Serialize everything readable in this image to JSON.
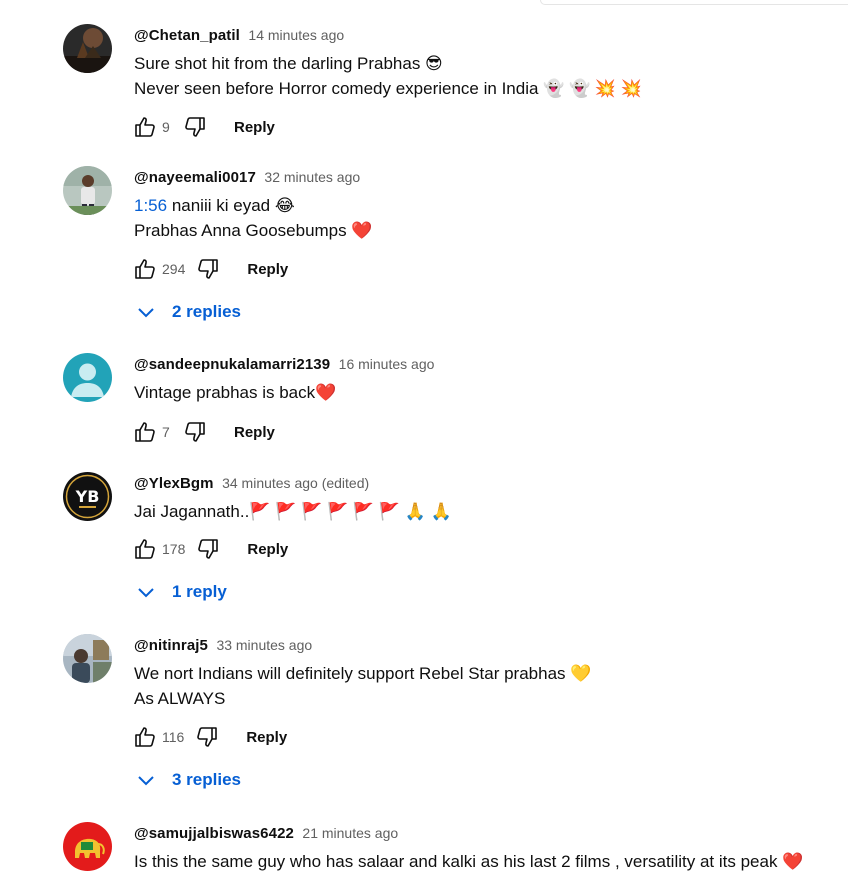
{
  "comments": [
    {
      "author": "@Chetan_patil",
      "time": "14 minutes ago",
      "lines": [
        {
          "timestamp": "",
          "text": "Sure shot hit from the darling Prabhas 😎"
        },
        {
          "timestamp": "",
          "text": "Never seen before Horror comedy experience in India 👻 👻 💥 💥"
        }
      ],
      "likes": "9",
      "reply_label": "Reply",
      "replies": ""
    },
    {
      "author": "@nayeemali0017",
      "time": "32 minutes ago",
      "lines": [
        {
          "timestamp": "1:56",
          "text": " naniii ki eyad 😂"
        },
        {
          "timestamp": "",
          "text": "Prabhas Anna Goosebumps ❤️"
        }
      ],
      "likes": "294",
      "reply_label": "Reply",
      "replies": "2 replies"
    },
    {
      "author": "@sandeepnukalamarri2139",
      "time": "16 minutes ago",
      "lines": [
        {
          "timestamp": "",
          "text": "Vintage prabhas is back❤️"
        }
      ],
      "likes": "7",
      "reply_label": "Reply",
      "replies": ""
    },
    {
      "author": "@YlexBgm",
      "time": "34 minutes ago (edited)",
      "lines": [
        {
          "timestamp": "",
          "text": "Jai Jagannath..🚩 🚩 🚩 🚩 🚩 🚩 🙏 🙏"
        }
      ],
      "likes": "178",
      "reply_label": "Reply",
      "replies": "1 reply"
    },
    {
      "author": "@nitinraj5",
      "time": "33 minutes ago",
      "lines": [
        {
          "timestamp": "",
          "text": "We nort Indians will definitely support Rebel Star prabhas 💛"
        },
        {
          "timestamp": "",
          "text": "As ALWAYS"
        }
      ],
      "likes": "116",
      "reply_label": "Reply",
      "replies": "3 replies"
    },
    {
      "author": "@samujjalbiswas6422",
      "time": "21 minutes ago",
      "lines": [
        {
          "timestamp": "",
          "text": "Is this the same guy who has  salaar and kalki as his last 2 films , versatility at its peak ❤️"
        }
      ],
      "likes": "",
      "reply_label": "",
      "replies": ""
    }
  ],
  "avatars": {
    "c3_default_color": "#22a3b8",
    "c4_logo_text": "YB",
    "c6_badge_color": "#e31b1b"
  },
  "icons": {
    "like": "thumb-up-icon",
    "dislike": "thumb-down-icon",
    "expand": "chevron-down-icon"
  },
  "accent_color": "#065fd4"
}
